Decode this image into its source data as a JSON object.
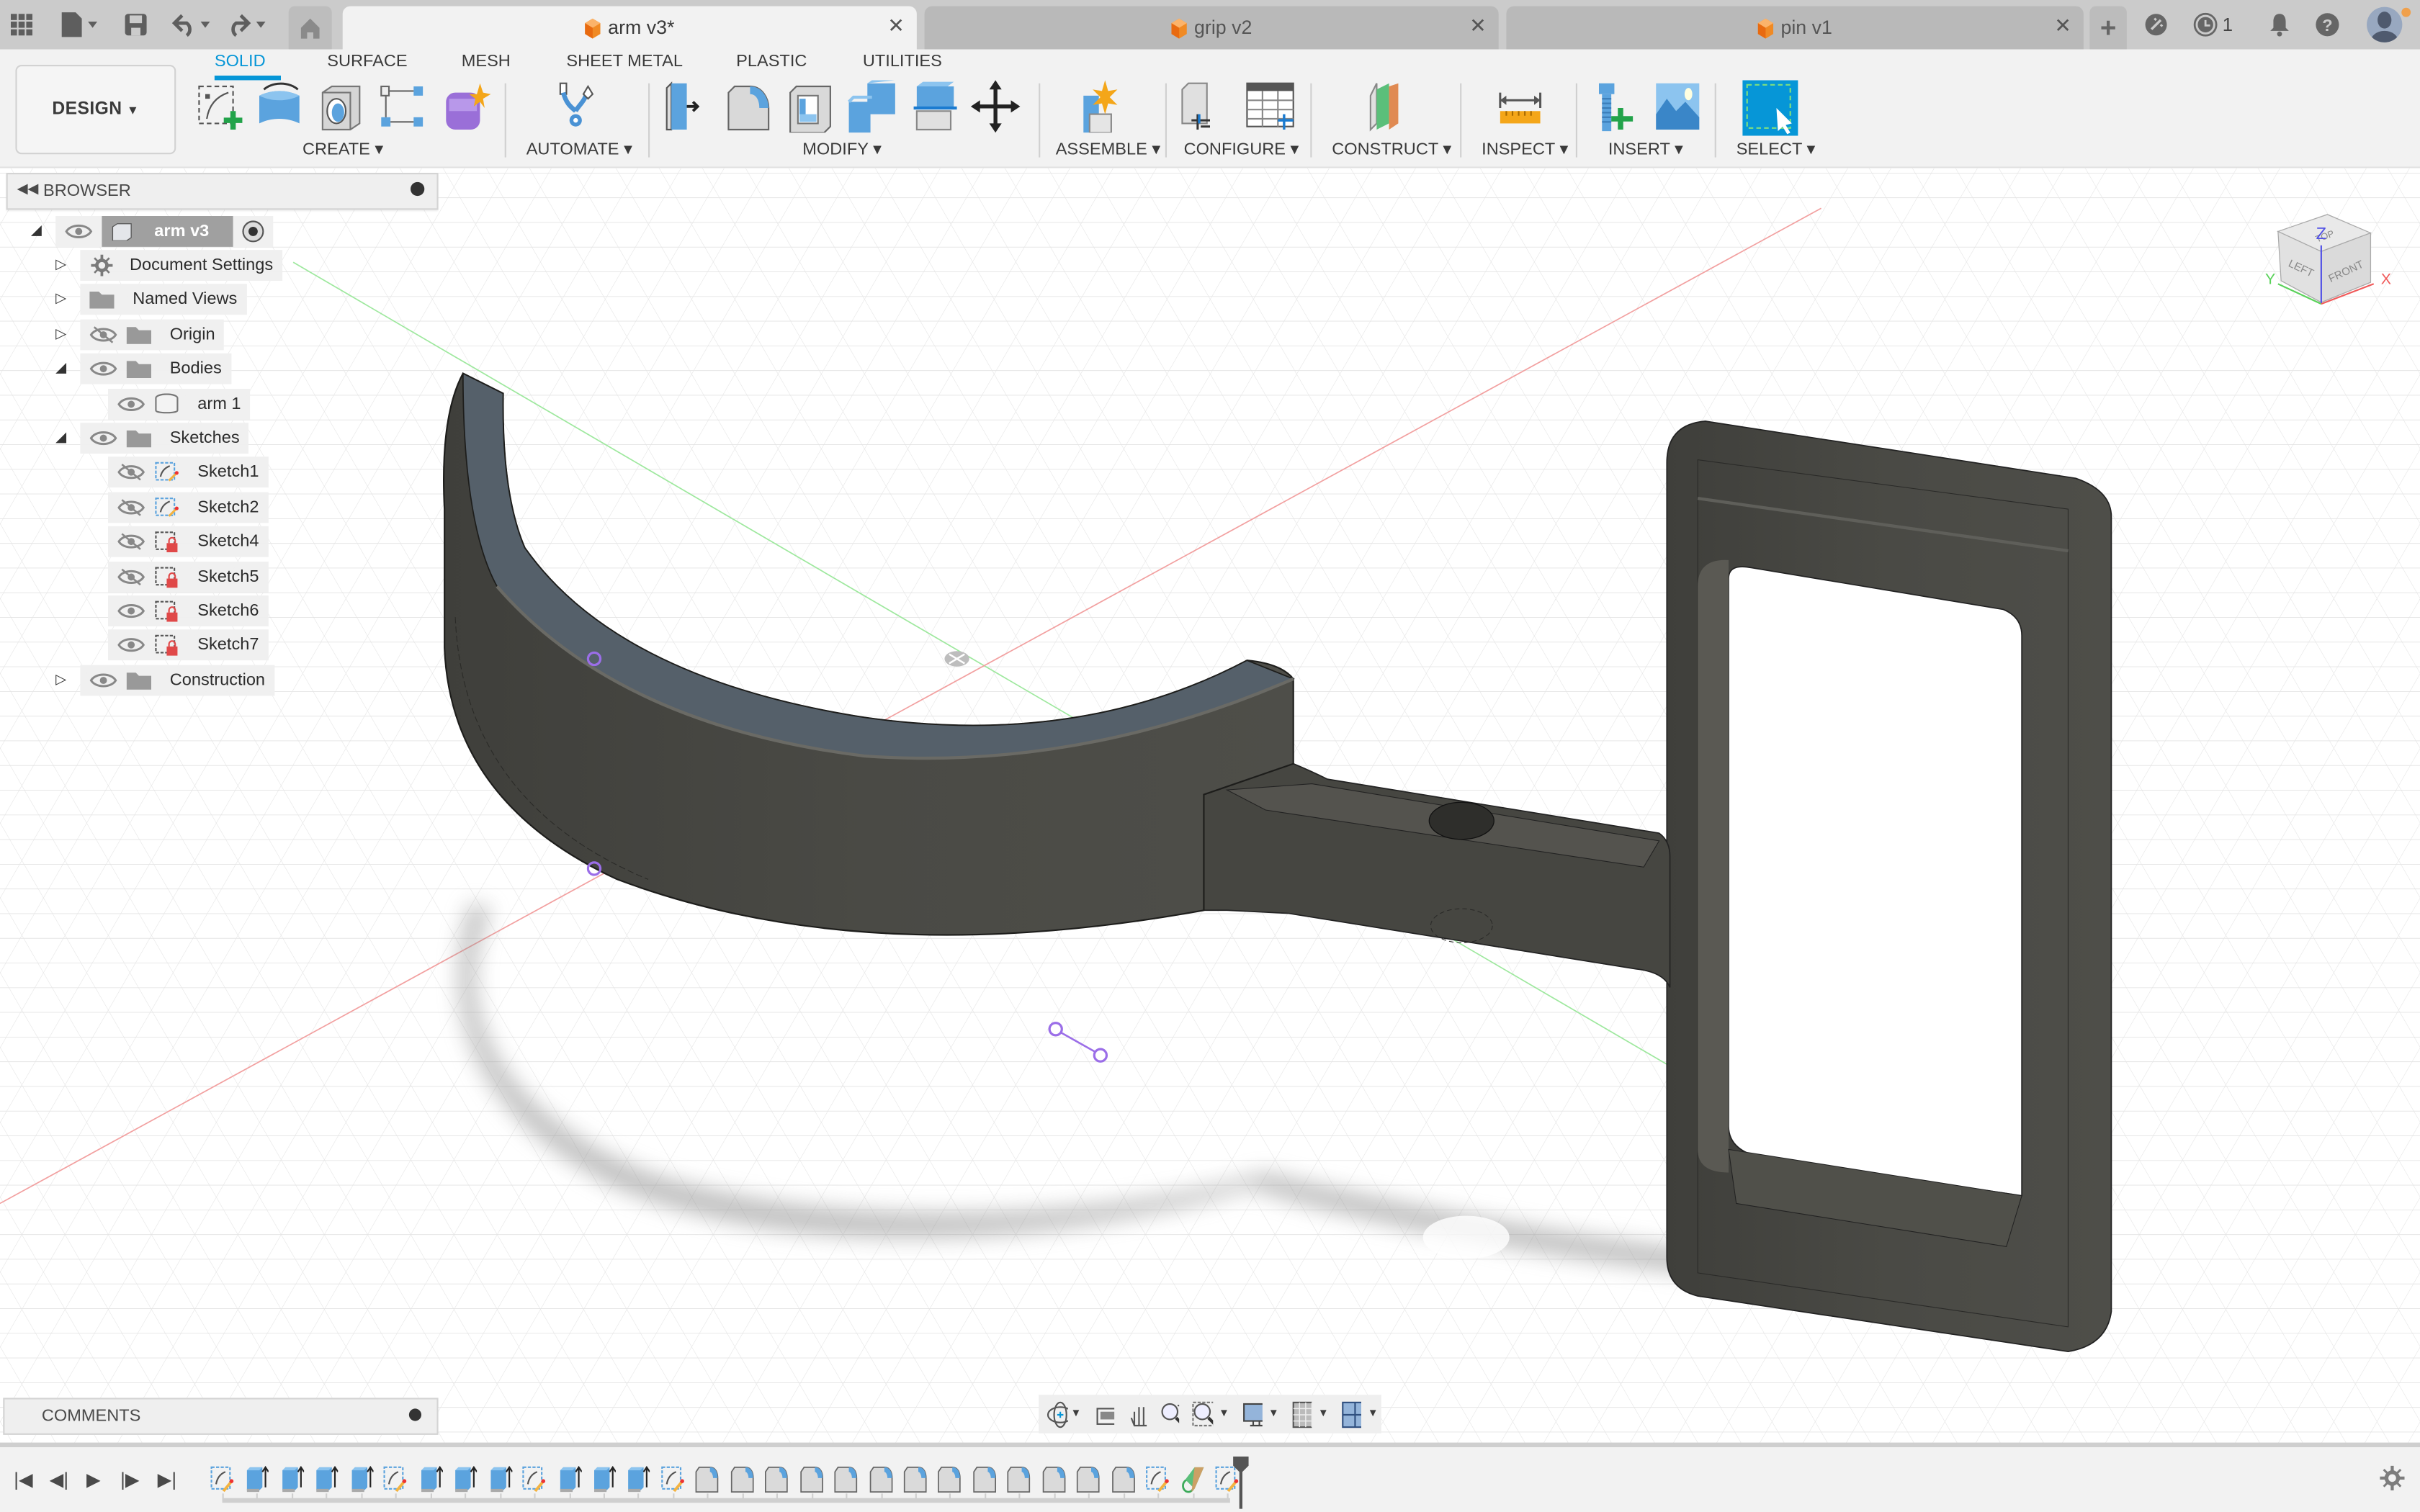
{
  "titlebar": {
    "icons": [
      "app-grid-icon",
      "file-icon",
      "save-icon",
      "undo-icon",
      "redo-icon",
      "home-icon"
    ],
    "tabs": [
      {
        "label": "arm v3*",
        "active": true
      },
      {
        "label": "grip v2",
        "active": false
      },
      {
        "label": "pin v1",
        "active": false
      }
    ],
    "new_tab_label": "+",
    "job_status_count": "1",
    "right_icons": [
      "extensions-icon",
      "job-status-icon",
      "notifications-icon",
      "help-icon",
      "user-avatar"
    ]
  },
  "toolbar": {
    "workspace_label": "DESIGN",
    "workspace_tabs": [
      "SOLID",
      "SURFACE",
      "MESH",
      "SHEET METAL",
      "PLASTIC",
      "UTILITIES"
    ],
    "active_workspace_tab": "SOLID",
    "groups": [
      {
        "label": "CREATE",
        "tools": [
          "create-sketch",
          "extrude",
          "hole",
          "pattern",
          "create-form"
        ]
      },
      {
        "label": "AUTOMATE",
        "tools": [
          "automate"
        ]
      },
      {
        "label": "MODIFY",
        "tools": [
          "press-pull",
          "fillet",
          "shell",
          "combine",
          "offset-face",
          "move-copy"
        ]
      },
      {
        "label": "ASSEMBLE",
        "tools": [
          "new-component"
        ]
      },
      {
        "label": "CONFIGURE",
        "tools": [
          "change-parameters",
          "configure-table"
        ]
      },
      {
        "label": "CONSTRUCT",
        "tools": [
          "offset-plane"
        ]
      },
      {
        "label": "INSPECT",
        "tools": [
          "measure"
        ]
      },
      {
        "label": "INSERT",
        "tools": [
          "insert-mcmaster",
          "insert-canvas"
        ]
      },
      {
        "label": "SELECT",
        "tools": [
          "select"
        ]
      }
    ],
    "accent": "#0696d7"
  },
  "browser": {
    "title": "BROWSER",
    "root": {
      "label": "arm v3"
    },
    "items": [
      {
        "label": "Document Settings",
        "depth": 1,
        "expander": "collapsed",
        "icon": "gear",
        "visible": null
      },
      {
        "label": "Named Views",
        "depth": 1,
        "expander": "collapsed",
        "icon": "folder",
        "visible": null
      },
      {
        "label": "Origin",
        "depth": 1,
        "expander": "collapsed",
        "icon": "folder",
        "visible": false
      },
      {
        "label": "Bodies",
        "depth": 1,
        "expander": "expanded",
        "icon": "folder",
        "visible": true
      },
      {
        "label": "arm 1",
        "depth": 2,
        "expander": "none",
        "icon": "body",
        "visible": true
      },
      {
        "label": "Sketches",
        "depth": 1,
        "expander": "expanded",
        "icon": "folder",
        "visible": true
      },
      {
        "label": "Sketch1",
        "depth": 2,
        "expander": "none",
        "icon": "sketch",
        "visible": false
      },
      {
        "label": "Sketch2",
        "depth": 2,
        "expander": "none",
        "icon": "sketch",
        "visible": false
      },
      {
        "label": "Sketch4",
        "depth": 2,
        "expander": "none",
        "icon": "sketch-locked",
        "visible": false
      },
      {
        "label": "Sketch5",
        "depth": 2,
        "expander": "none",
        "icon": "sketch-locked",
        "visible": false
      },
      {
        "label": "Sketch6",
        "depth": 2,
        "expander": "none",
        "icon": "sketch-locked",
        "visible": true
      },
      {
        "label": "Sketch7",
        "depth": 2,
        "expander": "none",
        "icon": "sketch-locked",
        "visible": true
      },
      {
        "label": "Construction",
        "depth": 1,
        "expander": "collapsed",
        "icon": "folder",
        "visible": true
      }
    ]
  },
  "viewcube": {
    "faces": [
      "TOP",
      "LEFT",
      "FRONT"
    ],
    "axes": [
      "X",
      "Y",
      "Z"
    ],
    "axis_colors": {
      "X": "#f05a5a",
      "Y": "#5ad25a",
      "Z": "#5050e6"
    }
  },
  "comments": {
    "title": "COMMENTS"
  },
  "navbar": {
    "tools": [
      "orbit",
      "look-at",
      "pan",
      "zoom",
      "fit",
      "display-settings",
      "grid-snaps",
      "viewports"
    ]
  },
  "timeline": {
    "controls": [
      "go-to-start",
      "step-back",
      "play",
      "step-forward",
      "go-to-end"
    ],
    "features": [
      "sketch",
      "extrude",
      "extrude",
      "extrude",
      "extrude",
      "sketch",
      "extrude",
      "extrude",
      "extrude",
      "sketch",
      "extrude",
      "extrude",
      "extrude",
      "sketch",
      "fillet",
      "fillet",
      "fillet",
      "fillet",
      "fillet",
      "fillet",
      "fillet",
      "fillet",
      "fillet",
      "fillet",
      "fillet",
      "fillet",
      "fillet",
      "sketch",
      "tangent-plane",
      "sketch"
    ]
  },
  "colors": {
    "body": "#4a4a46",
    "body_top": "#565f62",
    "sketch_points": "#9b6ee8"
  }
}
